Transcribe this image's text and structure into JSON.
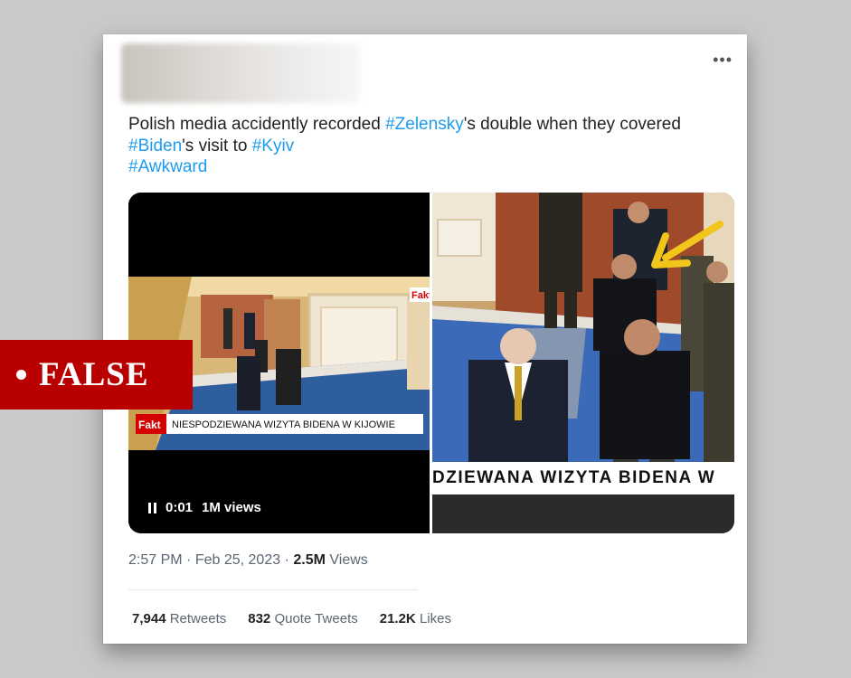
{
  "tweet": {
    "more_icon": "more-horizontal-icon",
    "text": {
      "part1": "Polish media accidently recorded ",
      "tag1": "#Zelensky",
      "part2": "'s double when they covered ",
      "tag2": "#Biden",
      "part3": "'s visit to ",
      "tag3": "#Kyiv",
      "tag4": "#Awkward"
    },
    "video": {
      "logo": "Fakt",
      "caption": "NIESPODZIEWANA WIZYTA BIDENA W KIJOWIE",
      "time": "0:01",
      "views": "1M views"
    },
    "right_image": {
      "ticker": "DZIEWANA WIZYTA BIDENA W"
    },
    "meta": {
      "time": "2:57 PM",
      "date": "Feb 25, 2023",
      "views_count": "2.5M",
      "views_label": "Views"
    },
    "stats": {
      "retweets_count": "7,944",
      "retweets_label": "Retweets",
      "quotes_count": "832",
      "quotes_label": "Quote Tweets",
      "likes_count": "21.2K",
      "likes_label": "Likes"
    }
  },
  "badge": {
    "label": "FALSE",
    "color": "#b80000"
  },
  "colors": {
    "hashtag": "#1d9bf0",
    "background": "#c9c9c9"
  }
}
